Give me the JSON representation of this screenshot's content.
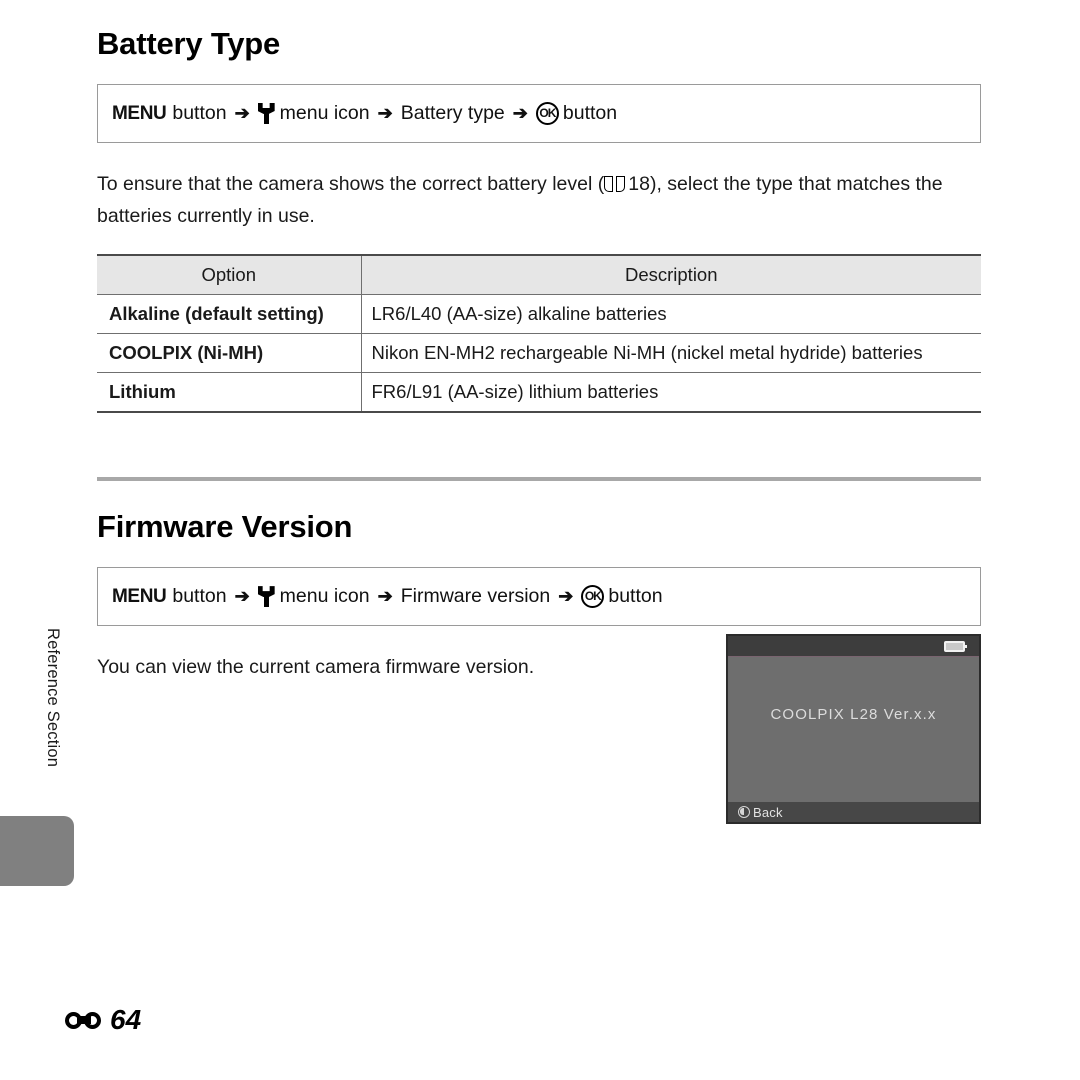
{
  "page": {
    "side_label": "Reference Section",
    "page_marker_icon": "e-reference-icon",
    "page_number": "64"
  },
  "sections": [
    {
      "title": "Battery Type",
      "nav": {
        "menu_label": "MENU",
        "button_word_1": "button",
        "arrow": "➔",
        "setup_icon": "wrench-icon",
        "menu_icon_label": "menu icon",
        "item_label": "Battery type",
        "ok_icon_text": "OK",
        "button_word_2": "button"
      },
      "body": {
        "text_before_ref": "To ensure that the camera shows the correct battery level (",
        "ref_icon": "book-icon",
        "ref_page": "18",
        "text_after_ref": "), select the type that matches the batteries currently in use."
      },
      "table": {
        "headers": [
          "Option",
          "Description"
        ],
        "rows": [
          [
            "Alkaline (default setting)",
            "LR6/L40 (AA-size) alkaline batteries"
          ],
          [
            "COOLPIX (Ni-MH)",
            "Nikon EN-MH2 rechargeable Ni-MH (nickel metal hydride) batteries"
          ],
          [
            "Lithium",
            "FR6/L91 (AA-size) lithium batteries"
          ]
        ]
      }
    },
    {
      "title": "Firmware Version",
      "nav": {
        "menu_label": "MENU",
        "button_word_1": "button",
        "arrow": "➔",
        "setup_icon": "wrench-icon",
        "menu_icon_label": "menu icon",
        "item_label": "Firmware version",
        "ok_icon_text": "OK",
        "button_word_2": "button"
      },
      "body": {
        "text": "You can view the current camera firmware version."
      }
    }
  ],
  "camera_screen": {
    "battery_icon": "battery-icon",
    "version_text": "COOLPIX L28 Ver.x.x",
    "back_icon": "back-icon",
    "back_label": "Back"
  },
  "colors": {
    "table_header_bg": "#e6e6e6",
    "divider": "#a8a8a8",
    "side_tab": "#808080",
    "screen_bg": "#6e6e6e"
  }
}
